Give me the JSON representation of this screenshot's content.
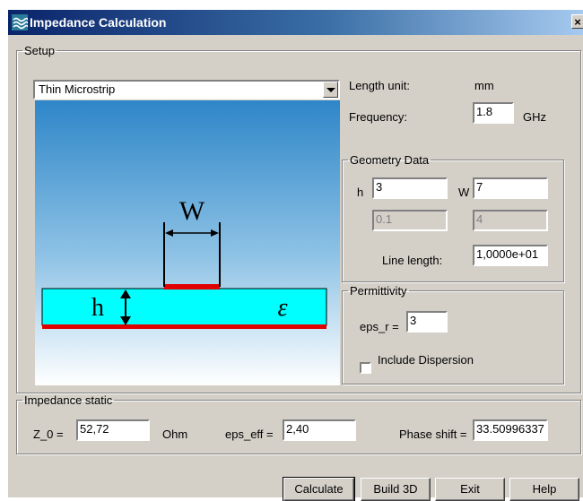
{
  "window": {
    "title": "Impedance Calculation",
    "close_label": "×"
  },
  "setup": {
    "legend": "Setup",
    "model": "Thin Microstrip",
    "length_unit_label": "Length unit:",
    "length_unit_value": "mm",
    "frequency_label": "Frequency:",
    "frequency_value": "1.8",
    "frequency_unit": "GHz"
  },
  "diagram": {
    "width_symbol": "W",
    "height_symbol": "h",
    "eps_symbol": "ε"
  },
  "geometry": {
    "legend": "Geometry Data",
    "h_label": "h",
    "h_value": "3",
    "w_label": "W",
    "w_value": "7",
    "h_secondary": "0.1",
    "w_secondary": "4",
    "line_length_label": "Line length:",
    "line_length_value": "1,0000e+01"
  },
  "permittivity": {
    "legend": "Permittivity",
    "eps_r_label": "eps_r =",
    "eps_r_value": "3",
    "dispersion_label": "Include Dispersion",
    "dispersion_checked": false
  },
  "impedance": {
    "legend": "Impedance static",
    "z0_label": "Z_0 =",
    "z0_value": "52,72",
    "z0_unit": "Ohm",
    "eps_eff_label": "eps_eff =",
    "eps_eff_value": "2,40",
    "phase_label": "Phase shift =",
    "phase_value": "33.50996337"
  },
  "buttons": {
    "calculate": "Calculate",
    "build3d": "Build 3D",
    "exit": "Exit",
    "help": "Help"
  },
  "colors": {
    "title_start": "#0a246a",
    "title_end": "#a6caf0",
    "sky_top": "#2e86c8",
    "substrate": "#00ffff",
    "conductor": "#e00000"
  }
}
